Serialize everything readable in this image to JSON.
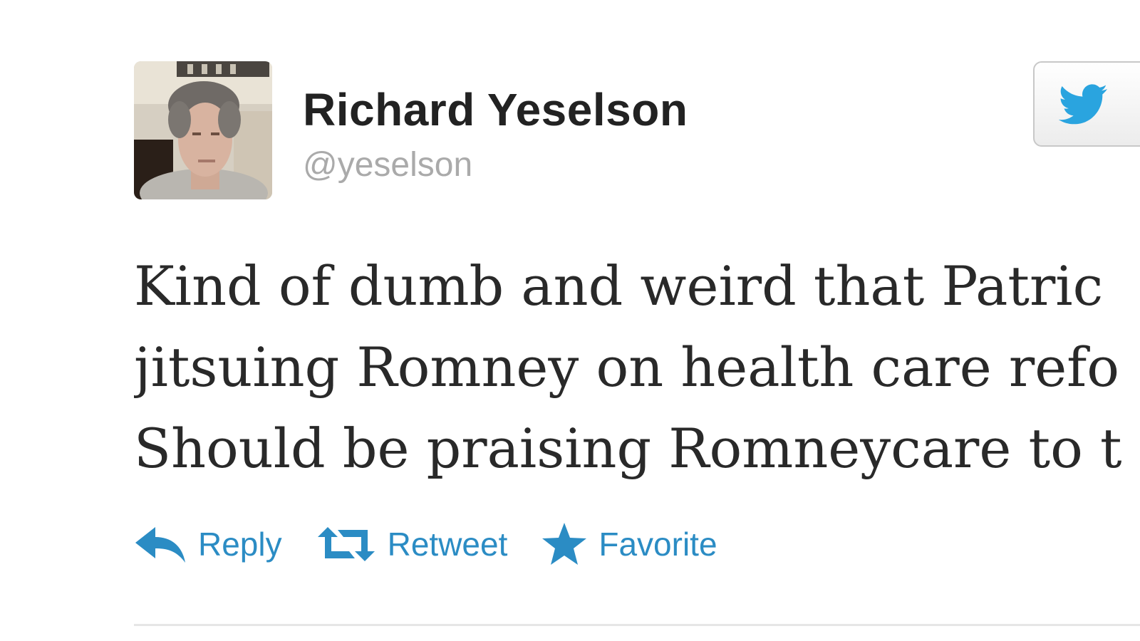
{
  "tweet": {
    "author": {
      "display_name": "Richard Yeselson",
      "screen_name": "@yeselson"
    },
    "text_lines": [
      "Kind of dumb and weird that Patric",
      "jitsuing Romney on health care refo",
      "Should be praising Romneycare to t"
    ],
    "actions": {
      "reply": "Reply",
      "retweet": "Retweet",
      "favorite": "Favorite"
    }
  },
  "icons": {
    "follow": "twitter-bird-icon",
    "reply": "reply-arrow-icon",
    "retweet": "retweet-icon",
    "favorite": "star-icon"
  },
  "colors": {
    "action_blue": "#2b8cc4",
    "bird_blue": "#2aa4df",
    "name_text": "#222222",
    "handle_text": "#aaaaaa",
    "body_text": "#292929"
  }
}
